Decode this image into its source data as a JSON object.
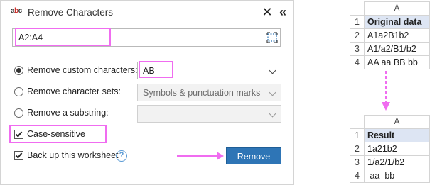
{
  "dialog": {
    "app_icon_prefix": "a",
    "app_icon_strike": "b",
    "app_icon_suffix": "c",
    "title": "Remove Characters",
    "close_icon": "close-icon",
    "collapse_icon": "double-chevron-left-icon",
    "range_value": "A2:A4",
    "range_select_icon": "range-select-icon",
    "options": [
      {
        "label": "Remove custom characters:",
        "selected": true,
        "combo_value": "AB",
        "enabled": true
      },
      {
        "label": "Remove character sets:",
        "selected": false,
        "combo_value": "Symbols & punctuation marks",
        "enabled": false
      },
      {
        "label": "Remove a substring:",
        "selected": false,
        "combo_value": "",
        "enabled": false
      }
    ],
    "case_sensitive": {
      "label": "Case-sensitive",
      "checked": true
    },
    "backup": {
      "label": "Back up this worksheet",
      "checked": true
    },
    "help_glyph": "?",
    "remove_button": "Remove",
    "highlight_color": "#f06cf0",
    "accent_color": "#2e75b6"
  },
  "sheet_original": {
    "column": "A",
    "header_row": "1",
    "header": "Original data",
    "rows": [
      {
        "num": "2",
        "value": "A1a2B1b2"
      },
      {
        "num": "3",
        "value": "A1/a2/B1/b2"
      },
      {
        "num": "4",
        "value": "AA aa BB bb"
      }
    ]
  },
  "sheet_result": {
    "column": "A",
    "header_row": "1",
    "header": "Result",
    "rows": [
      {
        "num": "2",
        "value": "1a21b2"
      },
      {
        "num": "3",
        "value": "1/a2/1/b2"
      },
      {
        "num": "4",
        "value": " aa  bb"
      }
    ]
  }
}
